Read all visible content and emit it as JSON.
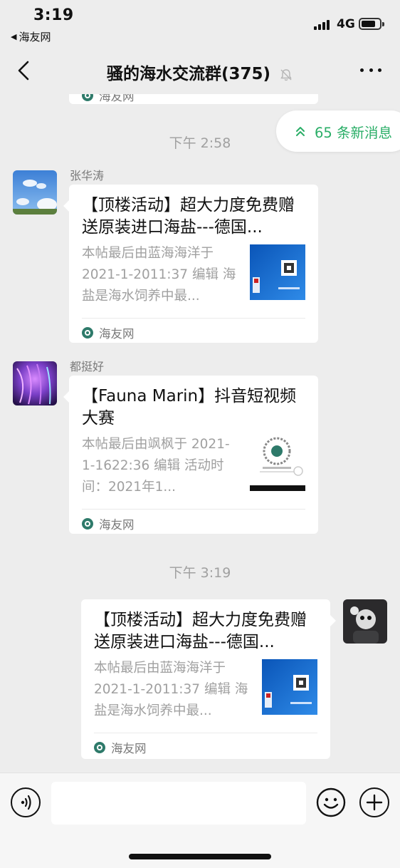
{
  "status_bar": {
    "time": "3:19",
    "back_app": "海友网",
    "network": "4G"
  },
  "nav": {
    "title": "骚的海水交流群(375)"
  },
  "new_messages": {
    "label": "65 条新消息"
  },
  "chat": {
    "partial_card_source": "海友网",
    "time_1": "下午 2:58",
    "time_2": "下午 3:19",
    "messages": [
      {
        "sender": "张华涛",
        "title": "【顶楼活动】超大力度免费赠送原装进口海盐---德国...",
        "desc": "本帖最后由蓝海海洋于 2021-1-2011:37 编辑 海盐是海水饲养中最...",
        "source": "海友网"
      },
      {
        "sender": "都挺好",
        "title": "【Fauna Marin】抖音短视频大赛",
        "desc": "本帖最后由飒枫于 2021-1-1622:36 编辑 活动时间：2021年1...",
        "source": "海友网"
      },
      {
        "sender": "",
        "title": "【顶楼活动】超大力度免费赠送原装进口海盐---德国...",
        "desc": "本帖最后由蓝海海洋于 2021-1-2011:37 编辑 海盐是海水饲养中最...",
        "source": "海友网"
      }
    ]
  },
  "input": {
    "placeholder": ""
  },
  "colors": {
    "accent_green": "#2aae67",
    "background": "#ededed"
  }
}
